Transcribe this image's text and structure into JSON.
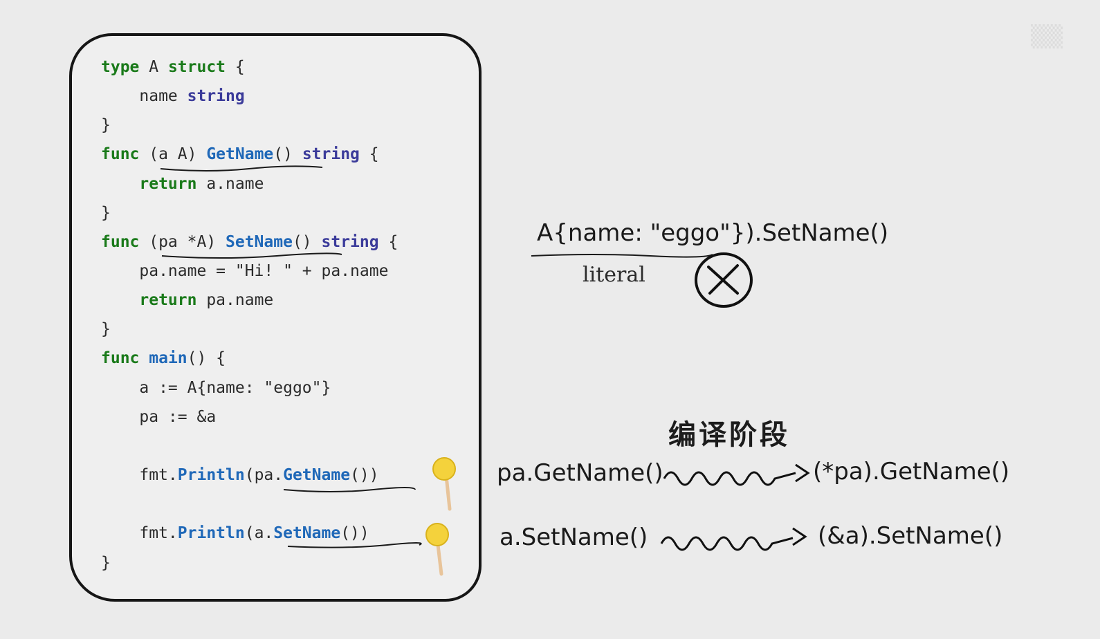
{
  "code": {
    "l1": {
      "kw": "type",
      "rest": " A ",
      "kw2": "struct",
      "tail": " {"
    },
    "l2": {
      "indent": "    ",
      "ident": "name ",
      "ty": "string"
    },
    "l3": {
      "text": "}"
    },
    "l4": {
      "kw": "func",
      "recv": " (a A) ",
      "fn": "GetName",
      "mid": "() ",
      "ty": "string",
      "tail": " {"
    },
    "l5": {
      "indent": "    ",
      "kw": "return",
      "rest": " a.name"
    },
    "l6": {
      "text": "}"
    },
    "l7": {
      "kw": "func",
      "recv": " (pa *A) ",
      "fn": "SetName",
      "mid": "() ",
      "ty": "string",
      "tail": " {"
    },
    "l8": {
      "text": "    pa.name = \"Hi! \" + pa.name"
    },
    "l9": {
      "indent": "    ",
      "kw": "return",
      "rest": " pa.name"
    },
    "l10": {
      "text": "}"
    },
    "l11": {
      "kw": "func",
      "sp": " ",
      "fn": "main",
      "tail": "() {"
    },
    "l12": {
      "text": "    a := A{name: \"eggo\"}"
    },
    "l13": {
      "text": "    pa := &a"
    },
    "l14": {
      "pre": "    fmt.",
      "fn1": "Println",
      "mid": "(pa.",
      "fn2": "GetName",
      "tail": "())"
    },
    "l15": {
      "pre": "    fmt.",
      "fn1": "Println",
      "mid": "(a.",
      "fn2": "SetName",
      "tail": "())"
    },
    "l16": {
      "text": "}"
    }
  },
  "annotations": {
    "literal_expr": "A{name: \"eggo\"}).SetName()",
    "literal_label": "literal",
    "error_mark": "✕",
    "phase_title": "编译阶段",
    "row1_left": "pa.GetName()",
    "row1_right": "(*pa).GetName()",
    "row2_left": "a.SetName()",
    "row2_right": "(&a).SetName()"
  },
  "colors": {
    "keyword": "#1a7a1a",
    "type": "#3b3b9a",
    "function": "#1f68b8",
    "lollipop": "#f4d23c"
  }
}
